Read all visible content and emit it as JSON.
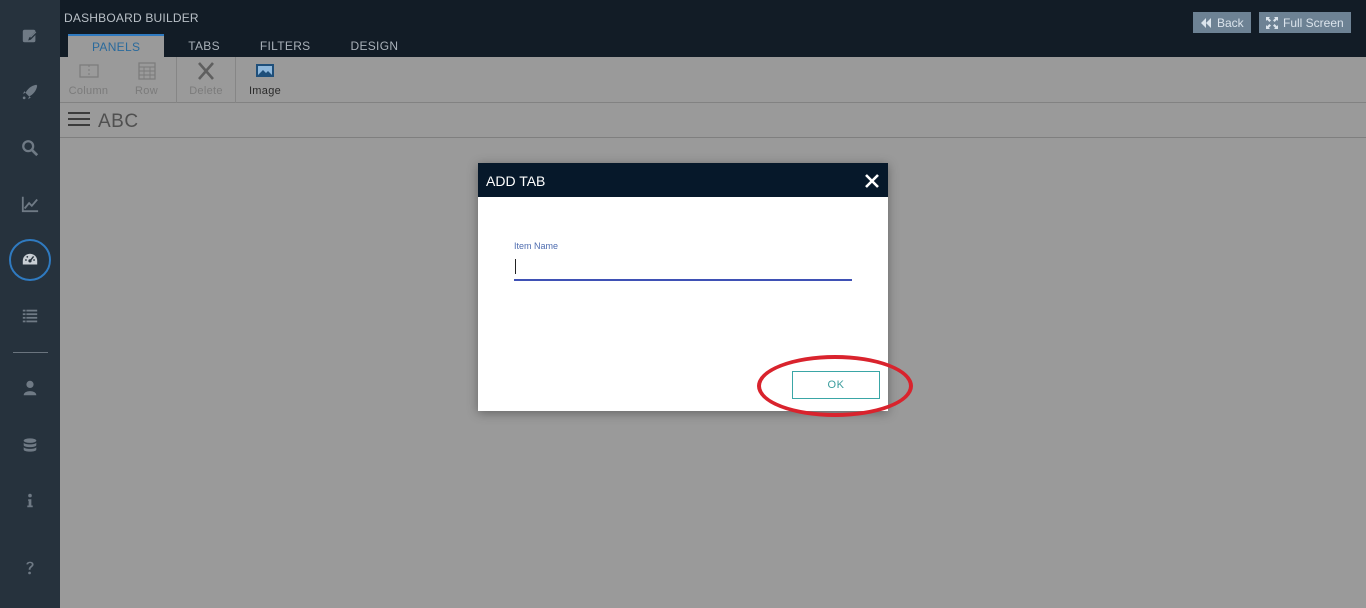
{
  "app": {
    "title": "DASHBOARD BUILDER"
  },
  "nav": {
    "icons": [
      "edit-icon",
      "rocket-icon",
      "search-icon",
      "chart-line-icon",
      "dashboard-gauge-icon",
      "list-icon",
      "user-icon",
      "database-icon",
      "info-icon",
      "help-icon"
    ],
    "active": "dashboard-gauge-icon",
    "accent_color": "#2f7ac0"
  },
  "tabs": [
    {
      "label": "PANELS",
      "active": true
    },
    {
      "label": "TABS",
      "active": false
    },
    {
      "label": "FILTERS",
      "active": false
    },
    {
      "label": "DESIGN",
      "active": false
    }
  ],
  "header_buttons": {
    "back_label": "Back",
    "fullscreen_label": "Full Screen"
  },
  "toolbar": {
    "column_label": "Column",
    "row_label": "Row",
    "delete_label": "Delete",
    "image_label": "Image"
  },
  "dashboard": {
    "name": "ABC"
  },
  "modal": {
    "title": "ADD TAB",
    "field_label": "Item Name",
    "field_value": "",
    "ok_label": "OK"
  },
  "colors": {
    "highlight": "#d9232d",
    "modal_header": "#06182a",
    "ok_border": "#3aa6a6"
  }
}
